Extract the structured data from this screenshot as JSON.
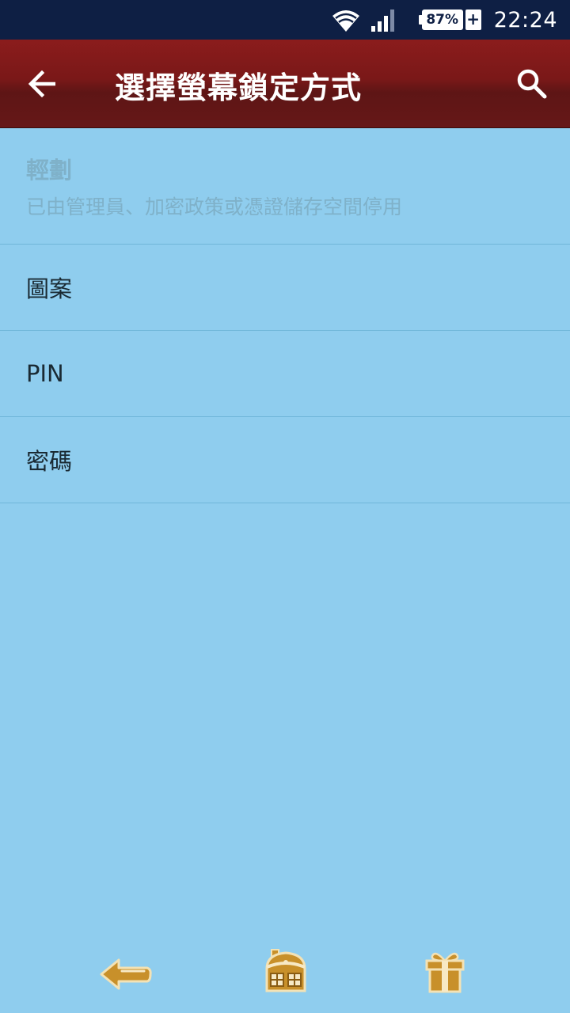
{
  "status_bar": {
    "battery_percent": "87%",
    "charging_symbol": "+",
    "time": "22:24",
    "icons": [
      "wifi-icon",
      "cell-signal-icon",
      "battery-icon"
    ]
  },
  "app_bar": {
    "title": "選擇螢幕鎖定方式",
    "back_icon": "arrow-left-icon",
    "search_icon": "search-icon"
  },
  "options": [
    {
      "label": "輕劃",
      "sublabel": "已由管理員、加密政策或憑證儲存空間停用",
      "enabled": false
    },
    {
      "label": "圖案",
      "enabled": true
    },
    {
      "label": "PIN",
      "enabled": true
    },
    {
      "label": "密碼",
      "enabled": true
    }
  ],
  "nav_bar": {
    "icons": [
      "back-arrow-icon",
      "home-icon",
      "gift-icon"
    ]
  },
  "colors": {
    "status_bar": "#0e1f44",
    "app_bar": "#7a1818",
    "background": "#8fcdee",
    "divider": "#70b6d9",
    "disabled_text": "#7fb1c9",
    "nav_icon": "#c8902a"
  }
}
